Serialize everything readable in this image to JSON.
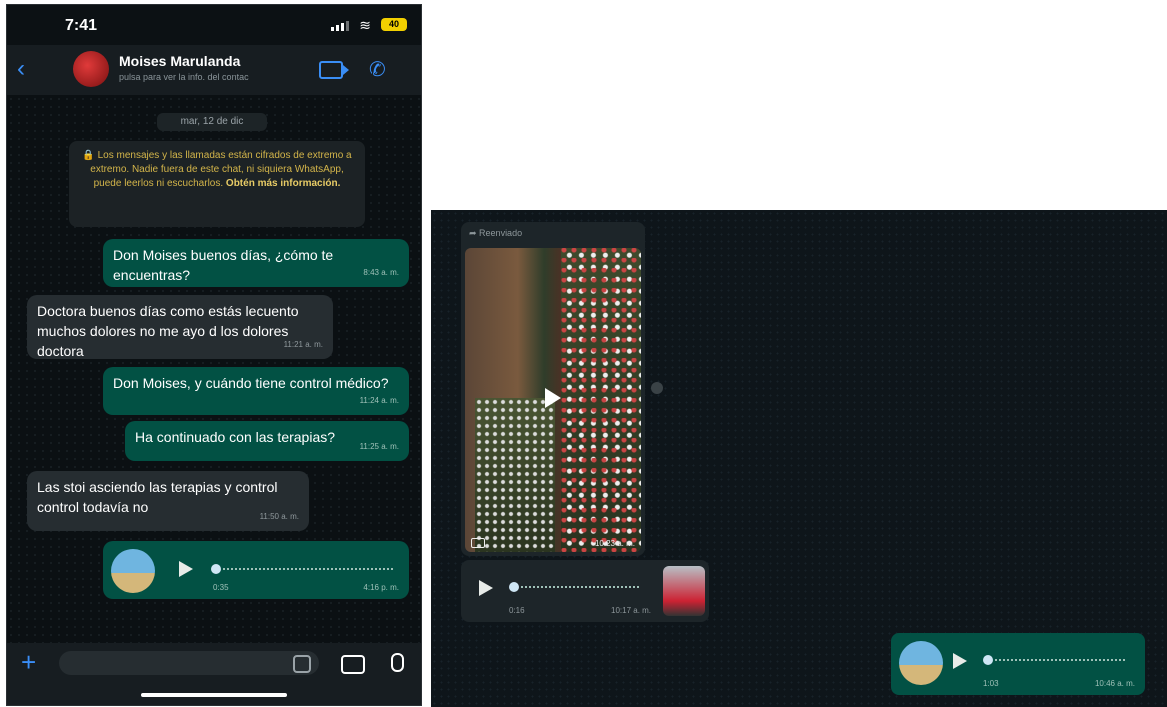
{
  "phone": {
    "status": {
      "time": "7:41",
      "battery": "40"
    },
    "header": {
      "contact_name": "Moises Marulanda",
      "contact_sub": "pulsa para ver la info. del contac"
    },
    "date_chip": "mar, 12 de dic",
    "encryption": {
      "text": "Los mensajes y las llamadas están cifrados de extremo a extremo. Nadie fuera de este chat, ni siquiera WhatsApp, puede leerlos ni escucharlos.",
      "link": "Obtén más información."
    },
    "messages": [
      {
        "dir": "out",
        "text": "Don Moises buenos días, ¿cómo te encuentras?",
        "time": "8:43 a. m."
      },
      {
        "dir": "in",
        "text": "Doctora buenos días como estás lecuento muchos dolores no me ayo d los dolores doctora",
        "time": "11:21 a. m."
      },
      {
        "dir": "out",
        "text": "Don Moises, y cuándo tiene control médico?",
        "time": "11:24 a. m."
      },
      {
        "dir": "out",
        "text": "Ha continuado con las terapias?",
        "time": "11:25 a. m."
      },
      {
        "dir": "in",
        "text": "Las stoi asciendo las terapias y control control todavía no",
        "time": "11:50 a. m."
      }
    ],
    "voice_note": {
      "duration": "0:35",
      "time": "4:16 p. m."
    }
  },
  "desktop": {
    "forwarded_label": "Reenviado",
    "video_time": "10:23 a. m.",
    "voice_in": {
      "duration": "0:16",
      "time": "10:17 a. m."
    },
    "voice_out": {
      "duration": "1:03",
      "time": "10:46 a. m."
    }
  },
  "colors": {
    "outgoing": "#025144",
    "incoming": "#262d31",
    "accent": "#3a8ef6",
    "background": "#0b1013"
  }
}
